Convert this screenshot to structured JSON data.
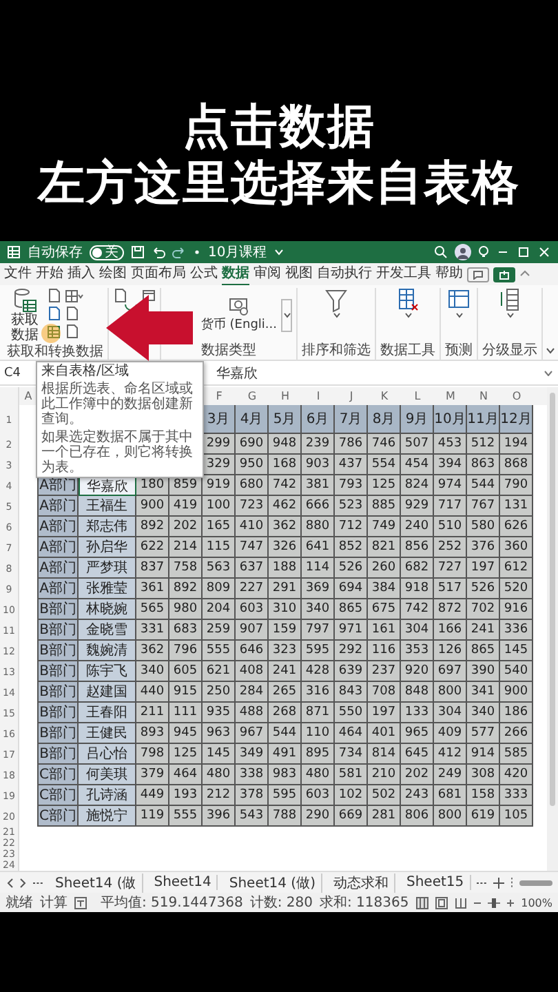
{
  "caption": [
    "点击数据",
    "左方这里选择来自表格"
  ],
  "title_bar": {
    "autosave": "自动保存",
    "autosave_toggle": {
      "on": false,
      "label": "关"
    },
    "filename": "10月课程"
  },
  "menu_tabs": [
    {
      "label": "文件",
      "selected": false
    },
    {
      "label": "开始",
      "selected": false
    },
    {
      "label": "插入",
      "selected": false
    },
    {
      "label": "绘图",
      "selected": false
    },
    {
      "label": "页面布局",
      "selected": false
    },
    {
      "label": "公式",
      "selected": false
    },
    {
      "label": "数据",
      "selected": true
    },
    {
      "label": "审阅",
      "selected": false
    },
    {
      "label": "视图",
      "selected": false
    },
    {
      "label": "自动执行",
      "selected": false
    },
    {
      "label": "开发工具",
      "selected": false
    },
    {
      "label": "帮助",
      "selected": false
    }
  ],
  "ribbon": {
    "get_data": "获取数据",
    "get_group": "获取和转换数据",
    "currency": "货币 (Engli...",
    "types_group": "数据类型",
    "sort_filter": "排序和筛选",
    "data_tools": "数据工具",
    "forecast": "预测",
    "outline": "分级显示"
  },
  "formula_bar": {
    "cell": "C4",
    "value": "华嘉欣"
  },
  "tooltip": {
    "title": "来自表格/区域",
    "paragraphs": [
      "根据所选表、命名区域或此工作簿中的数据创建新查询。",
      "如果选定数据不属于其中一个已存在，则它将转换为表。"
    ]
  },
  "sheet": {
    "column_letters": {
      "first": "A",
      "months": [
        "F",
        "G",
        "H",
        "I",
        "J",
        "K",
        "L",
        "M",
        "N",
        "O"
      ]
    },
    "row_numbers": [
      "1",
      "2",
      "3",
      "4",
      "5",
      "6",
      "7",
      "8",
      "9",
      "10",
      "11",
      "12",
      "13",
      "14",
      "15",
      "16",
      "17",
      "18",
      "19",
      "20",
      "21",
      "22",
      "23",
      "24"
    ],
    "header": [
      "3月",
      "4月",
      "5月",
      "6月",
      "7月",
      "8月",
      "9月",
      "10月",
      "11月",
      "12月"
    ],
    "rows": [
      {
        "values": [
          "299",
          "690",
          "948",
          "239",
          "786",
          "746",
          "507",
          "453",
          "512",
          "194"
        ]
      },
      {
        "values": [
          "329",
          "950",
          "168",
          "903",
          "437",
          "554",
          "454",
          "394",
          "863",
          "868"
        ]
      },
      {
        "dept": "A部门",
        "name": "华嘉欣",
        "name_active": true,
        "values": [
          "180",
          "859",
          "919",
          "680",
          "742",
          "381",
          "793",
          "125",
          "824",
          "974",
          "544",
          "790"
        ]
      },
      {
        "dept": "A部门",
        "name": "王福生",
        "name_active": false,
        "values": [
          "900",
          "419",
          "100",
          "723",
          "462",
          "666",
          "523",
          "885",
          "929",
          "717",
          "767",
          "131"
        ]
      },
      {
        "dept": "A部门",
        "name": "郑志伟",
        "name_active": false,
        "values": [
          "892",
          "202",
          "165",
          "410",
          "362",
          "880",
          "712",
          "749",
          "240",
          "510",
          "580",
          "626"
        ]
      },
      {
        "dept": "A部门",
        "name": "孙启华",
        "name_active": false,
        "values": [
          "622",
          "214",
          "115",
          "747",
          "326",
          "641",
          "852",
          "821",
          "856",
          "252",
          "376",
          "360"
        ]
      },
      {
        "dept": "A部门",
        "name": "严梦琪",
        "name_active": false,
        "values": [
          "837",
          "758",
          "563",
          "637",
          "188",
          "114",
          "526",
          "260",
          "682",
          "727",
          "197",
          "612"
        ]
      },
      {
        "dept": "A部门",
        "name": "张雅莹",
        "name_active": false,
        "values": [
          "361",
          "892",
          "809",
          "227",
          "291",
          "369",
          "694",
          "384",
          "918",
          "517",
          "526",
          "520"
        ]
      },
      {
        "dept": "B部门",
        "name": "林晓婉",
        "name_active": false,
        "values": [
          "565",
          "980",
          "204",
          "603",
          "310",
          "340",
          "865",
          "675",
          "742",
          "872",
          "702",
          "916"
        ]
      },
      {
        "dept": "B部门",
        "name": "金晓雪",
        "name_active": false,
        "values": [
          "331",
          "683",
          "259",
          "907",
          "159",
          "797",
          "971",
          "161",
          "304",
          "166",
          "241",
          "336"
        ]
      },
      {
        "dept": "B部门",
        "name": "魏婉清",
        "name_active": false,
        "values": [
          "362",
          "796",
          "555",
          "646",
          "323",
          "595",
          "292",
          "116",
          "353",
          "126",
          "865",
          "145"
        ]
      },
      {
        "dept": "B部门",
        "name": "陈宇飞",
        "name_active": false,
        "values": [
          "340",
          "605",
          "621",
          "408",
          "241",
          "428",
          "639",
          "237",
          "920",
          "697",
          "390",
          "540"
        ]
      },
      {
        "dept": "B部门",
        "name": "赵建国",
        "name_active": false,
        "values": [
          "440",
          "915",
          "250",
          "284",
          "265",
          "316",
          "843",
          "708",
          "848",
          "800",
          "341",
          "900"
        ]
      },
      {
        "dept": "B部门",
        "name": "王春阳",
        "name_active": false,
        "values": [
          "211",
          "111",
          "935",
          "488",
          "268",
          "871",
          "550",
          "197",
          "133",
          "304",
          "340",
          "186"
        ]
      },
      {
        "dept": "B部门",
        "name": "王健民",
        "name_active": false,
        "values": [
          "893",
          "945",
          "963",
          "967",
          "544",
          "110",
          "464",
          "401",
          "965",
          "409",
          "577",
          "266"
        ]
      },
      {
        "dept": "B部门",
        "name": "吕心怡",
        "name_active": false,
        "values": [
          "798",
          "125",
          "145",
          "349",
          "491",
          "895",
          "734",
          "814",
          "645",
          "412",
          "914",
          "585"
        ]
      },
      {
        "dept": "C部门",
        "name": "何美琪",
        "name_active": false,
        "values": [
          "379",
          "464",
          "480",
          "338",
          "983",
          "480",
          "581",
          "210",
          "202",
          "249",
          "308",
          "420"
        ]
      },
      {
        "dept": "C部门",
        "name": "孔诗涵",
        "name_active": false,
        "values": [
          "449",
          "193",
          "212",
          "378",
          "595",
          "603",
          "102",
          "502",
          "243",
          "681",
          "158",
          "333"
        ]
      },
      {
        "dept": "C部门",
        "name": "施悦宁",
        "name_active": false,
        "values": [
          "119",
          "555",
          "396",
          "543",
          "788",
          "290",
          "669",
          "281",
          "806",
          "800",
          "619",
          "105"
        ]
      }
    ]
  },
  "sheet_tabs": [
    "Sheet14 (做",
    "Sheet14",
    "Sheet14 (做)",
    "动态求和",
    "Sheet15"
  ],
  "status_bar": {
    "mode": "就绪",
    "calc": "计算",
    "average": "平均值: 519.1447368",
    "count": "计数: 280",
    "sum": "求和: 118365",
    "zoom": {
      "level": 0.55,
      "reading": "100%"
    }
  }
}
